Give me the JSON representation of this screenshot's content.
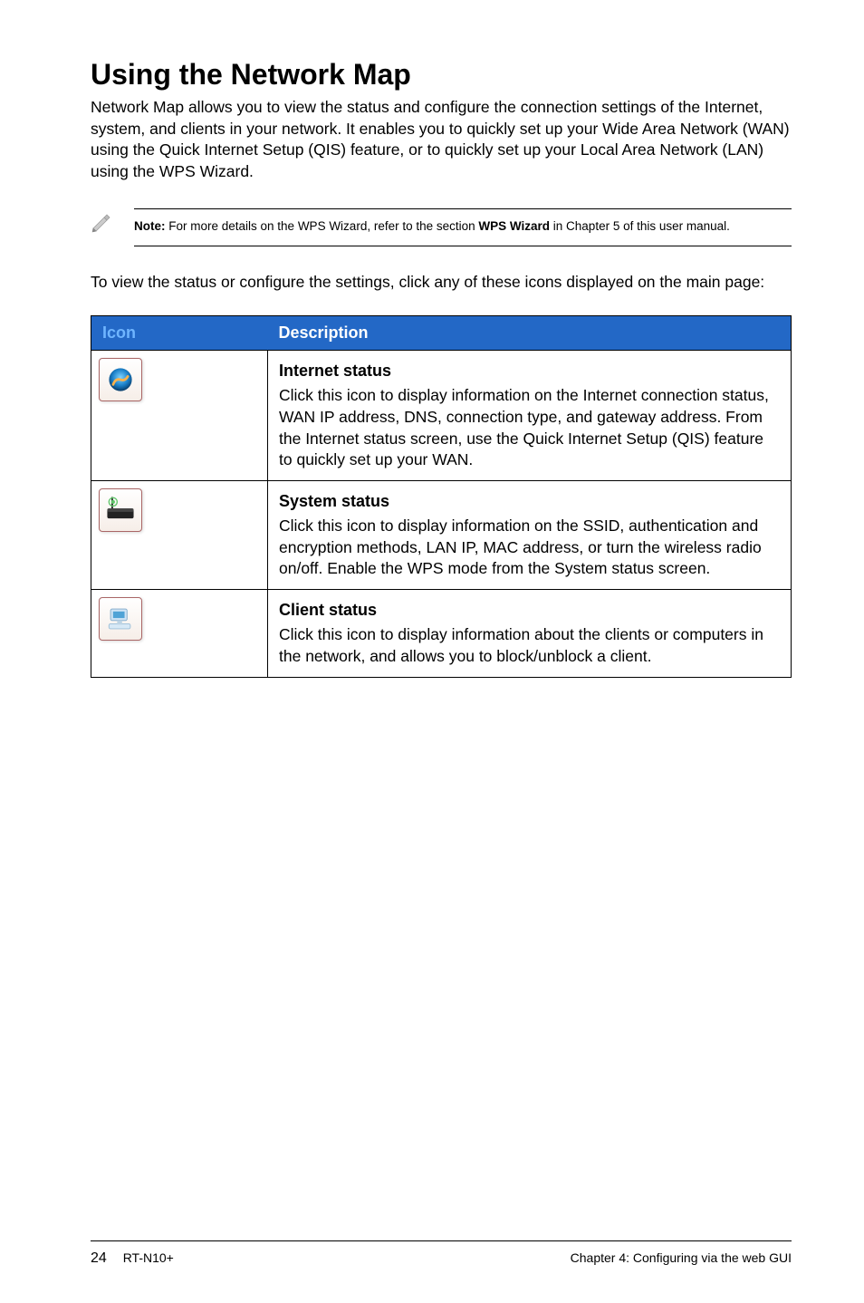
{
  "heading": "Using the Network Map",
  "intro": "Network Map allows you to view the status and configure the connection settings of the Internet, system, and clients in your network. It enables you to quickly set up your Wide Area Network (WAN) using the Quick Internet Setup (QIS) feature, or to quickly set up your Local Area Network (LAN) using the WPS Wizard.",
  "note": {
    "label": "Note:",
    "pre": " For more details on the WPS Wizard, refer to the section ",
    "bold": "WPS Wizard",
    "post": " in Chapter 5 of this user manual."
  },
  "lead": "To view the status or configure the settings, click any of these icons displayed on the main page:",
  "table": {
    "headers": {
      "icon": "Icon",
      "desc": "Description"
    },
    "rows": [
      {
        "icon_name": "internet-status-icon",
        "title": "Internet status",
        "body": "Click this icon to display information on the Internet connection status, WAN IP address, DNS, connection type, and gateway address. From the Internet status screen, use the Quick Internet Setup (QIS) feature to quickly set up your WAN."
      },
      {
        "icon_name": "system-status-icon",
        "title": "System status",
        "body": "Click this icon to display information on the SSID, authentication and encryption methods, LAN IP, MAC address, or turn the wireless radio on/off. Enable the WPS mode from the System status screen."
      },
      {
        "icon_name": "client-status-icon",
        "title": "Client status",
        "body": "Click this icon to display information about the clients or computers in the network, and allows you to block/unblock a client."
      }
    ]
  },
  "footer": {
    "page": "24",
    "model": "RT-N10+",
    "chapter": "Chapter 4: Configuring via the web GUI"
  }
}
